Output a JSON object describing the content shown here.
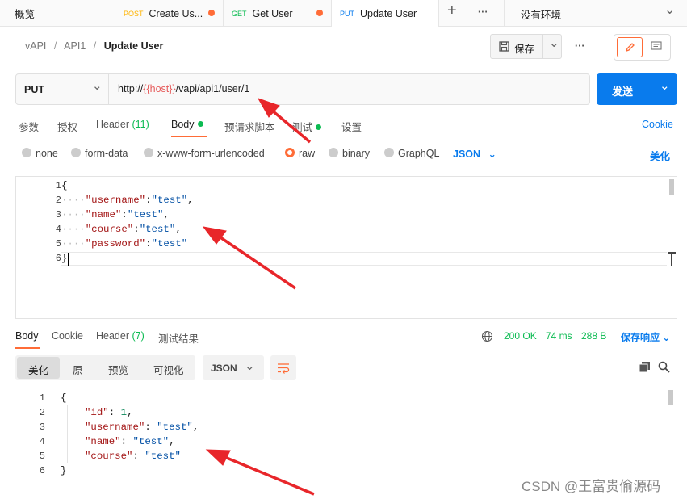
{
  "tabs": {
    "first": "概览",
    "items": [
      {
        "method": "POST",
        "title": "Create Us...",
        "method_color": "#ffb400"
      },
      {
        "method": "GET",
        "title": "Get User",
        "method_color": "#0cbb52"
      },
      {
        "method": "PUT",
        "title": "Update User",
        "method_color": "#097bed"
      }
    ],
    "add": "+",
    "more": "···",
    "environment": "没有环境",
    "env_chevron": "⌄"
  },
  "breadcrumb": {
    "a": "vAPI",
    "b": "API1",
    "sep": "/",
    "current": "Update User"
  },
  "toolbar": {
    "save": "保存",
    "save_chevron": "⌄",
    "more": "···"
  },
  "request": {
    "method": "PUT",
    "method_chevron": "⌄",
    "url_prefix": "http://",
    "url_var": "{{host}}",
    "url_suffix": "/vapi/api1/user/1",
    "send": "发送",
    "send_chevron": "⌄"
  },
  "req_tabs": [
    "参数",
    "授权",
    "Header",
    "(11)",
    "Body",
    "预请求脚本",
    "测试",
    "设置"
  ],
  "cookie": "Cookie",
  "body_types": [
    "none",
    "form-data",
    "x-www-form-urlencoded",
    "raw",
    "binary",
    "GraphQL"
  ],
  "format": "JSON",
  "format_chevron": "⌄",
  "beautify": "美化",
  "req_body": {
    "lines": [
      "1",
      "2",
      "3",
      "4",
      "5",
      "6"
    ],
    "brace_open": "{",
    "brace_close": "}",
    "fields": [
      {
        "indent": "····",
        "key": "\"username\"",
        "colon": ":",
        "val": "\"test\"",
        "comma": ","
      },
      {
        "indent": "····",
        "key": "\"name\"",
        "colon": ":",
        "val": "\"test\"",
        "comma": ","
      },
      {
        "indent": "····",
        "key": "\"course\"",
        "colon": ":",
        "val": "\"test\"",
        "comma": ","
      },
      {
        "indent": "····",
        "key": "\"password\"",
        "colon": ":",
        "val": "\"test\"",
        "comma": ""
      }
    ]
  },
  "resp_tabs": [
    "Body",
    "Cookie",
    "Header",
    "(7)",
    "测试结果"
  ],
  "resp_status": {
    "status": "200 OK",
    "time": "74 ms",
    "size": "288 B",
    "save": "保存响应",
    "save_chevron": "⌄"
  },
  "view_modes": [
    "美化",
    "原",
    "预览",
    "可视化"
  ],
  "resp_format": "JSON",
  "resp_format_chevron": "⌄",
  "resp_body": {
    "lines": [
      "1",
      "2",
      "3",
      "4",
      "5",
      "6"
    ],
    "brace_open": "{",
    "brace_close": "}",
    "fields": [
      {
        "key": "\"id\"",
        "colon": ": ",
        "val": "1",
        "comma": ","
      },
      {
        "key": "\"username\"",
        "colon": ": ",
        "val": "\"test\"",
        "comma": ","
      },
      {
        "key": "\"name\"",
        "colon": ": ",
        "val": "\"test\"",
        "comma": ","
      },
      {
        "key": "\"course\"",
        "colon": ": ",
        "val": "\"test\"",
        "comma": ""
      }
    ]
  },
  "watermark": "CSDN @王富贵偷源码",
  "colors": {
    "accent": "#ff6c37",
    "send": "#097bed",
    "link": "#097bed",
    "green": "#0cbb52",
    "arrow": "#e8262a"
  }
}
